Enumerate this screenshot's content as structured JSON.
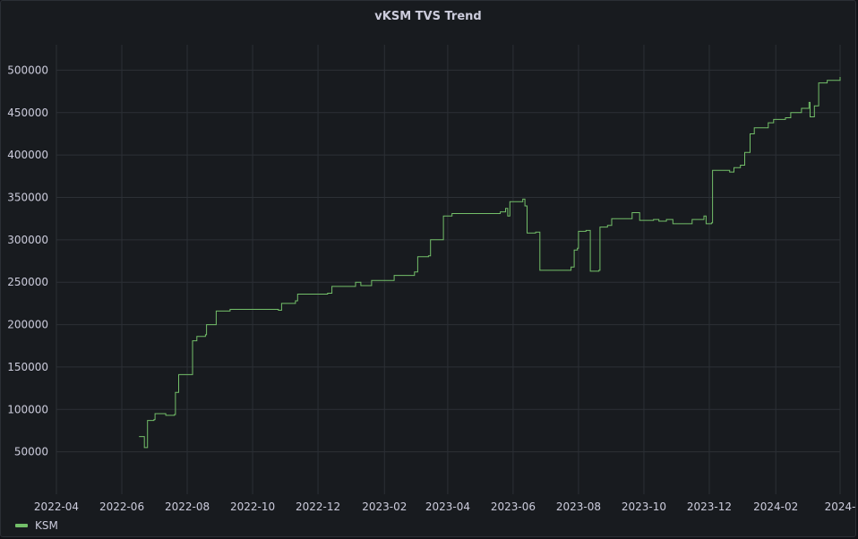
{
  "panel": {
    "title": "vKSM TVS Trend"
  },
  "legend": {
    "items": [
      {
        "label": "KSM",
        "color": "#73bf69"
      }
    ]
  },
  "chart_data": {
    "type": "line",
    "title": "vKSM TVS Trend",
    "xlabel": "",
    "ylabel": "",
    "x_ticks": [
      "2022-04",
      "2022-06",
      "2022-08",
      "2022-10",
      "2022-12",
      "2023-02",
      "2023-04",
      "2023-06",
      "2023-08",
      "2023-10",
      "2023-12",
      "2024-02",
      "2024-"
    ],
    "y_ticks": [
      50000,
      100000,
      150000,
      200000,
      250000,
      300000,
      350000,
      400000,
      450000,
      500000
    ],
    "ylim": [
      0,
      530000
    ],
    "grid": true,
    "legend": "bottom-left",
    "series": [
      {
        "name": "KSM",
        "color": "#73bf69",
        "points": [
          [
            "2022-06-17",
            68000
          ],
          [
            "2022-06-21",
            68000
          ],
          [
            "2022-06-22",
            55000
          ],
          [
            "2022-06-24",
            55000
          ],
          [
            "2022-06-25",
            87000
          ],
          [
            "2022-07-01",
            88000
          ],
          [
            "2022-07-02",
            95000
          ],
          [
            "2022-07-10",
            95000
          ],
          [
            "2022-07-12",
            93000
          ],
          [
            "2022-07-20",
            94000
          ],
          [
            "2022-07-21",
            120000
          ],
          [
            "2022-07-23",
            120000
          ],
          [
            "2022-07-24",
            141000
          ],
          [
            "2022-08-05",
            141000
          ],
          [
            "2022-08-06",
            181000
          ],
          [
            "2022-08-10",
            186000
          ],
          [
            "2022-08-18",
            188000
          ],
          [
            "2022-08-19",
            200000
          ],
          [
            "2022-08-26",
            200000
          ],
          [
            "2022-08-28",
            216000
          ],
          [
            "2022-09-10",
            218000
          ],
          [
            "2022-10-15",
            218000
          ],
          [
            "2022-10-25",
            217000
          ],
          [
            "2022-10-28",
            225000
          ],
          [
            "2022-11-10",
            228000
          ],
          [
            "2022-11-12",
            236000
          ],
          [
            "2022-12-10",
            237000
          ],
          [
            "2022-12-14",
            245000
          ],
          [
            "2023-01-05",
            250000
          ],
          [
            "2023-01-10",
            246000
          ],
          [
            "2023-01-20",
            252000
          ],
          [
            "2023-02-10",
            258000
          ],
          [
            "2023-03-01",
            262000
          ],
          [
            "2023-03-04",
            280000
          ],
          [
            "2023-03-14",
            281000
          ],
          [
            "2023-03-16",
            300000
          ],
          [
            "2023-03-25",
            300000
          ],
          [
            "2023-03-28",
            328000
          ],
          [
            "2023-04-05",
            331000
          ],
          [
            "2023-05-20",
            333000
          ],
          [
            "2023-05-25",
            337000
          ],
          [
            "2023-05-27",
            328000
          ],
          [
            "2023-05-29",
            345000
          ],
          [
            "2023-06-10",
            348000
          ],
          [
            "2023-06-12",
            340000
          ],
          [
            "2023-06-14",
            308000
          ],
          [
            "2023-06-22",
            309000
          ],
          [
            "2023-06-26",
            264000
          ],
          [
            "2023-07-25",
            268000
          ],
          [
            "2023-07-28",
            288000
          ],
          [
            "2023-07-31",
            290000
          ],
          [
            "2023-08-01",
            310000
          ],
          [
            "2023-08-08",
            311000
          ],
          [
            "2023-08-12",
            263000
          ],
          [
            "2023-08-20",
            264000
          ],
          [
            "2023-08-21",
            315000
          ],
          [
            "2023-08-28",
            317000
          ],
          [
            "2023-09-01",
            325000
          ],
          [
            "2023-09-20",
            332000
          ],
          [
            "2023-09-25",
            332000
          ],
          [
            "2023-09-27",
            323000
          ],
          [
            "2023-10-10",
            324000
          ],
          [
            "2023-10-15",
            322000
          ],
          [
            "2023-10-22",
            324000
          ],
          [
            "2023-10-28",
            319000
          ],
          [
            "2023-11-15",
            324000
          ],
          [
            "2023-11-26",
            328000
          ],
          [
            "2023-11-28",
            319000
          ],
          [
            "2023-12-03",
            320000
          ],
          [
            "2023-12-04",
            382000
          ],
          [
            "2023-12-20",
            380000
          ],
          [
            "2023-12-24",
            385000
          ],
          [
            "2023-12-30",
            388000
          ],
          [
            "2024-01-03",
            403000
          ],
          [
            "2024-01-08",
            425000
          ],
          [
            "2024-01-12",
            432000
          ],
          [
            "2024-01-25",
            438000
          ],
          [
            "2024-01-30",
            442000
          ],
          [
            "2024-02-10",
            444000
          ],
          [
            "2024-02-15",
            450000
          ],
          [
            "2024-02-25",
            455000
          ],
          [
            "2024-03-01",
            455000
          ],
          [
            "2024-03-03",
            462000
          ],
          [
            "2024-03-04",
            445000
          ],
          [
            "2024-03-07",
            445000
          ],
          [
            "2024-03-08",
            458000
          ],
          [
            "2024-03-11",
            458000
          ],
          [
            "2024-03-12",
            485000
          ],
          [
            "2024-03-20",
            488000
          ],
          [
            "2024-04-01",
            492000
          ]
        ]
      }
    ]
  }
}
